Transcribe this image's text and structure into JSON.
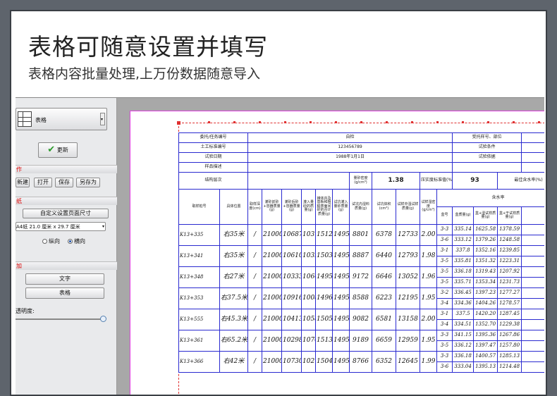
{
  "hero": {
    "title": "表格可随意设置并填写",
    "subtitle": "表格内容批量处理,上万份数据随意导入"
  },
  "panel": {
    "dropdown_value": "表格",
    "update_button": "更新",
    "section1_mark": "作",
    "file_buttons": [
      "新建",
      "打开",
      "保存",
      "另存为"
    ],
    "section2_mark": "纸",
    "custom_size_button": "自定义设置页面尺寸",
    "paper_select": "A4纸 21.0 厘米 x 29.7 厘米",
    "orientation": {
      "portrait": "纵向",
      "landscape": "横向",
      "selected": "landscape"
    },
    "section3_mark": "加",
    "text_button": "文字",
    "table_button": "表格",
    "opacity_label": "透明度:"
  },
  "sheet": {
    "info_rows": [
      {
        "label": "委托/任务编号",
        "value": "自检",
        "right_label": "受托样号、部位"
      },
      {
        "label": "土工标准编号",
        "value": "123456789",
        "right_label": "试验条件"
      },
      {
        "label": "试验日期",
        "value": "1988年1月1日",
        "right_label": "试验依据"
      },
      {
        "label": "样品描述",
        "value": "",
        "right_label": ""
      }
    ],
    "param_row": {
      "label": "结构层次",
      "unit": "量砂密度 (g/cm³)",
      "value": "1.38",
      "label2": "压实度标准值(%)",
      "value2": "93",
      "label3": "最佳含水率(%)"
    },
    "headers": [
      "取样桩号",
      "具体位置",
      "取样深度(cm)",
      "灌砂前砂+容器质量(g)",
      "灌砂后砂+容器质量(g)",
      "灌入量砂的质量(g)",
      "锥体内及基板和粗糙表面间砂的合计质量(g)",
      "试坑灌入量砂质量(g)",
      "试坑内湿料质量(g)",
      "试坑体积(cm³)",
      "试样中湿试样质量(g)",
      "试样湿密度(g/cm³)",
      "盒号",
      "盒质量(g)",
      "盒+湿试样质量(g)",
      "盒+干试样质量(g)"
    ],
    "moisture_header": "含水率",
    "rows": [
      {
        "station": "K13+335",
        "pos": "右35米",
        "depth": "/",
        "before": "21000",
        "after": "10687",
        "fill": "10313",
        "cone": "1512",
        "pit": "1495",
        "wet": "8801",
        "vol": "6378",
        "sample": "12733",
        "density": "2.00",
        "boxes": [
          [
            "3-3",
            "335.14",
            "1625.58",
            "1378.59"
          ],
          [
            "3-6",
            "333.12",
            "1379.26",
            "1248.58"
          ]
        ]
      },
      {
        "station": "K13+341",
        "pos": "右35米",
        "depth": "/",
        "before": "21000",
        "after": "10610",
        "fill": "10390",
        "cone": "1503",
        "pit": "1495",
        "wet": "8887",
        "vol": "6440",
        "sample": "12793",
        "density": "1.98",
        "boxes": [
          [
            "3-1",
            "337.8",
            "1352.16",
            "1239.85"
          ],
          [
            "3-5",
            "335.81",
            "1351.32",
            "1223.31"
          ]
        ]
      },
      {
        "station": "K13+348",
        "pos": "右27米",
        "depth": "/",
        "before": "21000",
        "after": "10333",
        "fill": "10667",
        "cone": "1495",
        "pit": "1495",
        "wet": "9172",
        "vol": "6646",
        "sample": "13052",
        "density": "1.96",
        "boxes": [
          [
            "3-5",
            "336.18",
            "1319.43",
            "1207.92"
          ],
          [
            "3-5",
            "335.71",
            "1353.34",
            "1231.73"
          ]
        ]
      },
      {
        "station": "K13+353",
        "pos": "右37.5米",
        "depth": "/",
        "before": "21000",
        "after": "10916",
        "fill": "10084",
        "cone": "1496",
        "pit": "1495",
        "wet": "8588",
        "vol": "6223",
        "sample": "12195",
        "density": "1.95",
        "boxes": [
          [
            "3-2",
            "336.45",
            "1397.23",
            "1277.27"
          ],
          [
            "3-4",
            "334.36",
            "1404.26",
            "1278.57"
          ]
        ]
      },
      {
        "station": "K13+555",
        "pos": "右45.3米",
        "depth": "/",
        "before": "21000",
        "after": "10413",
        "fill": "10587",
        "cone": "1505",
        "pit": "1495",
        "wet": "9082",
        "vol": "6581",
        "sample": "13158",
        "density": "2.00",
        "boxes": [
          [
            "3-1",
            "337.5",
            "1420.20",
            "1287.45"
          ],
          [
            "3-4",
            "334.51",
            "1352.70",
            "1229.38"
          ]
        ]
      },
      {
        "station": "K13+361",
        "pos": "右65.2米",
        "depth": "/",
        "before": "21000",
        "after": "10298",
        "fill": "10702",
        "cone": "1513",
        "pit": "1495",
        "wet": "9189",
        "vol": "6659",
        "sample": "12959",
        "density": "1.95",
        "boxes": [
          [
            "3-3",
            "341.15",
            "1395.36",
            "1267.86"
          ],
          [
            "3-5",
            "336.12",
            "1397.47",
            "1257.80"
          ]
        ]
      },
      {
        "station": "K13+366",
        "pos": "右42米",
        "depth": "/",
        "before": "21000",
        "after": "10730",
        "fill": "10270",
        "cone": "1504",
        "pit": "1495",
        "wet": "8766",
        "vol": "6352",
        "sample": "12645",
        "density": "1.99",
        "boxes": [
          [
            "3-3",
            "336.18",
            "1400.57",
            "1285.13"
          ],
          [
            "3-6",
            "333.04",
            "1395.13",
            "1214.48"
          ]
        ]
      }
    ]
  }
}
